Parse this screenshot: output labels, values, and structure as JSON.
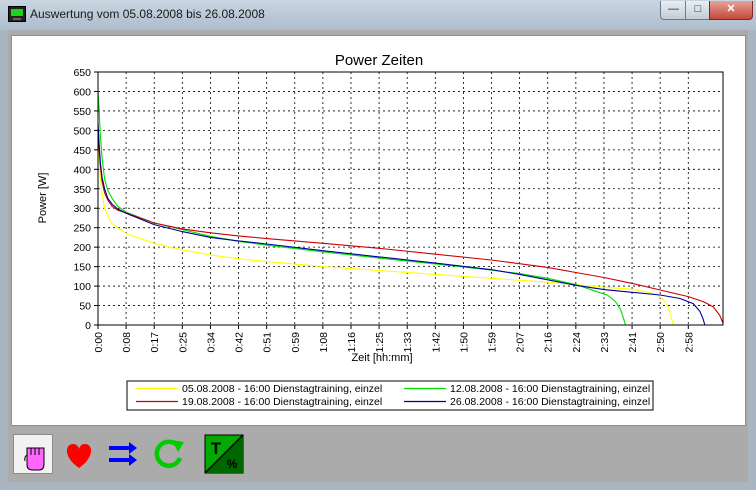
{
  "window": {
    "title": "Auswertung vom 05.08.2008  bis 26.08.2008",
    "controls": {
      "minimize": "—",
      "maximize": "□",
      "close": "✕"
    }
  },
  "chart_data": {
    "type": "line",
    "title": "Power  Zeiten",
    "xlabel": "Zeit  [hh:mm]",
    "ylabel": "Power [W]",
    "ylim": [
      0,
      650
    ],
    "y_ticks": [
      0,
      50,
      100,
      150,
      200,
      250,
      300,
      350,
      400,
      450,
      500,
      550,
      600,
      650
    ],
    "xlim_minutes": [
      0,
      189
    ],
    "x_ticks": [
      {
        "label": "0:00",
        "minutes": 0
      },
      {
        "label": "0:08",
        "minutes": 8.5
      },
      {
        "label": "0:17",
        "minutes": 17
      },
      {
        "label": "0:25",
        "minutes": 25.5
      },
      {
        "label": "0:34",
        "minutes": 34
      },
      {
        "label": "0:42",
        "minutes": 42.5
      },
      {
        "label": "0:51",
        "minutes": 51
      },
      {
        "label": "0:59",
        "minutes": 59.5
      },
      {
        "label": "1:08",
        "minutes": 68
      },
      {
        "label": "1:16",
        "minutes": 76.5
      },
      {
        "label": "1:25",
        "minutes": 85
      },
      {
        "label": "1:33",
        "minutes": 93.5
      },
      {
        "label": "1:42",
        "minutes": 102
      },
      {
        "label": "1:50",
        "minutes": 110.5
      },
      {
        "label": "1:59",
        "minutes": 119
      },
      {
        "label": "2:07",
        "minutes": 127.5
      },
      {
        "label": "2:16",
        "minutes": 136
      },
      {
        "label": "2:24",
        "minutes": 144.5
      },
      {
        "label": "2:33",
        "minutes": 153
      },
      {
        "label": "2:41",
        "minutes": 161.5
      },
      {
        "label": "2:50",
        "minutes": 170
      },
      {
        "label": "2:58",
        "minutes": 178.5
      }
    ],
    "grid": true,
    "legend_position": "bottom",
    "series": [
      {
        "name": "05.08.2008 - 16:00  Dienstagtraining, einzel",
        "color": "#ffff00",
        "points": [
          [
            0,
            500
          ],
          [
            0.3,
            430
          ],
          [
            0.7,
            380
          ],
          [
            1.2,
            340
          ],
          [
            2,
            300
          ],
          [
            3,
            280
          ],
          [
            4.3,
            260
          ],
          [
            6,
            250
          ],
          [
            8.5,
            235
          ],
          [
            17,
            210
          ],
          [
            25.5,
            193
          ],
          [
            34,
            180
          ],
          [
            42.5,
            170
          ],
          [
            51,
            163
          ],
          [
            68,
            150
          ],
          [
            85,
            140
          ],
          [
            102,
            130
          ],
          [
            119,
            120
          ],
          [
            136,
            110
          ],
          [
            153,
            97
          ],
          [
            161,
            92
          ],
          [
            166,
            85
          ],
          [
            169,
            78
          ],
          [
            171,
            65
          ],
          [
            172.5,
            45
          ],
          [
            173.5,
            15
          ],
          [
            174,
            0
          ]
        ]
      },
      {
        "name": "12.08.2008 - 16:00  Dienstagtraining, einzel",
        "color": "#00dd00",
        "points": [
          [
            0,
            600
          ],
          [
            0.3,
            560
          ],
          [
            0.7,
            490
          ],
          [
            1.2,
            430
          ],
          [
            2,
            375
          ],
          [
            3,
            345
          ],
          [
            4.3,
            325
          ],
          [
            6,
            305
          ],
          [
            8.5,
            290
          ],
          [
            17,
            262
          ],
          [
            25.5,
            245
          ],
          [
            34,
            228
          ],
          [
            42.5,
            215
          ],
          [
            51,
            205
          ],
          [
            68,
            188
          ],
          [
            85,
            172
          ],
          [
            102,
            157
          ],
          [
            119,
            141
          ],
          [
            127.5,
            132
          ],
          [
            136,
            120
          ],
          [
            144.5,
            104
          ],
          [
            150,
            88
          ],
          [
            154,
            77
          ],
          [
            156.5,
            60
          ],
          [
            158,
            40
          ],
          [
            159,
            15
          ],
          [
            159.5,
            0
          ]
        ]
      },
      {
        "name": "19.08.2008 - 16:00  Dienstagtraining, einzel",
        "color": "#cc0000",
        "points": [
          [
            0,
            510
          ],
          [
            0.3,
            460
          ],
          [
            0.7,
            410
          ],
          [
            1.2,
            370
          ],
          [
            2,
            340
          ],
          [
            3,
            320
          ],
          [
            4.3,
            305
          ],
          [
            6,
            295
          ],
          [
            8.5,
            288
          ],
          [
            17,
            262
          ],
          [
            25.5,
            247
          ],
          [
            34,
            237
          ],
          [
            42.5,
            229
          ],
          [
            51,
            222
          ],
          [
            68,
            210
          ],
          [
            85,
            197
          ],
          [
            102,
            182
          ],
          [
            119,
            167
          ],
          [
            136,
            148
          ],
          [
            144.5,
            135
          ],
          [
            153,
            122
          ],
          [
            161.5,
            107
          ],
          [
            170,
            90
          ],
          [
            178.5,
            73
          ],
          [
            183,
            60
          ],
          [
            186,
            47
          ],
          [
            188,
            25
          ],
          [
            189,
            5
          ]
        ]
      },
      {
        "name": "26.08.2008 - 16:00  Dienstagtraining, einzel",
        "color": "#000099",
        "points": [
          [
            0,
            520
          ],
          [
            0.3,
            470
          ],
          [
            0.7,
            420
          ],
          [
            1.2,
            380
          ],
          [
            2,
            350
          ],
          [
            3,
            325
          ],
          [
            4.3,
            310
          ],
          [
            6,
            298
          ],
          [
            8.5,
            287
          ],
          [
            17,
            258
          ],
          [
            25.5,
            240
          ],
          [
            34,
            225
          ],
          [
            42.5,
            216
          ],
          [
            51,
            208
          ],
          [
            68,
            191
          ],
          [
            85,
            175
          ],
          [
            102,
            159
          ],
          [
            119,
            142
          ],
          [
            127.5,
            130
          ],
          [
            136,
            116
          ],
          [
            144.5,
            102
          ],
          [
            153,
            91
          ],
          [
            161.5,
            84
          ],
          [
            170,
            77
          ],
          [
            176,
            68
          ],
          [
            180,
            55
          ],
          [
            182,
            35
          ],
          [
            183,
            15
          ],
          [
            183.5,
            0
          ]
        ]
      }
    ]
  },
  "toolbar": [
    {
      "name": "power-hand-icon",
      "selected": true
    },
    {
      "name": "heart-icon",
      "color": "#ff0000"
    },
    {
      "name": "transfer-arrows-icon",
      "color": "#0000ff"
    },
    {
      "name": "refresh-icon",
      "color": "#00cc00"
    },
    {
      "name": "time-percent-icon",
      "label_main": "T",
      "label_sub": "%"
    }
  ]
}
